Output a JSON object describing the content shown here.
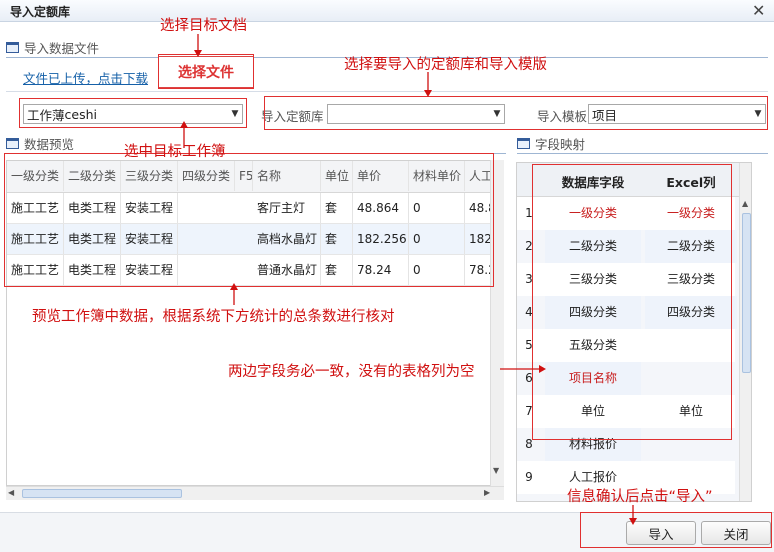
{
  "window": {
    "title": "导入定额库"
  },
  "upload_panel": {
    "header": "导入数据文件",
    "status_link": "文件已上传，点击下载",
    "choose_button": "选择文件"
  },
  "selects": {
    "workbook_label": "工作薄",
    "workbook_value": "ceshi",
    "quota_label": "导入定额库",
    "quota_value": "",
    "template_label": "导入模板",
    "template_value": "项目"
  },
  "preview": {
    "header": "数据预览",
    "columns": [
      "一级分类",
      "二级分类",
      "三级分类",
      "四级分类",
      "F5",
      "名称",
      "单位",
      "单价",
      "材料单价",
      "人工"
    ],
    "rows": [
      [
        "施工工艺",
        "电类工程",
        "安装工程",
        "",
        "",
        "客厅主灯",
        "套",
        "48.864",
        "0",
        "48.8"
      ],
      [
        "施工工艺",
        "电类工程",
        "安装工程",
        "",
        "",
        "高档水晶灯",
        "套",
        "182.256",
        "0",
        "182"
      ],
      [
        "施工工艺",
        "电类工程",
        "安装工程",
        "",
        "",
        "普通水晶灯",
        "套",
        "78.24",
        "0",
        "78.2"
      ]
    ]
  },
  "mapping": {
    "header": "字段映射",
    "col_db": "数据库字段",
    "col_excel": "Excel列",
    "rows": [
      {
        "num": "1",
        "db": "一级分类",
        "excel": "一级分类",
        "red": true
      },
      {
        "num": "2",
        "db": "二级分类",
        "excel": "二级分类",
        "red": false
      },
      {
        "num": "3",
        "db": "三级分类",
        "excel": "三级分类",
        "red": false
      },
      {
        "num": "4",
        "db": "四级分类",
        "excel": "四级分类",
        "red": false
      },
      {
        "num": "5",
        "db": "五级分类",
        "excel": "",
        "red": false
      },
      {
        "num": "6",
        "db": "项目名称",
        "excel": "",
        "red": true
      },
      {
        "num": "7",
        "db": "单位",
        "excel": "单位",
        "red": false
      },
      {
        "num": "8",
        "db": "材料报价",
        "excel": "",
        "red": false
      },
      {
        "num": "9",
        "db": "人工报价",
        "excel": "",
        "red": false
      }
    ]
  },
  "buttons": {
    "import": "导入",
    "close": "关闭"
  },
  "annotations": {
    "select_target_doc": "选择目标文档",
    "select_quota_template": "选择要导入的定额库和导入模版",
    "select_workbook": "选中目标工作簿",
    "preview_verify": "预览工作簿中数据，根据系统下方统计的总条数进行核对",
    "fields_match": "两边字段务必一致，没有的表格列为空",
    "confirm_import": "信息确认后点击“导入”"
  },
  "colors": {
    "annotation": "#d01010",
    "required_field": "#c81e1e",
    "link": "#1560a8"
  }
}
